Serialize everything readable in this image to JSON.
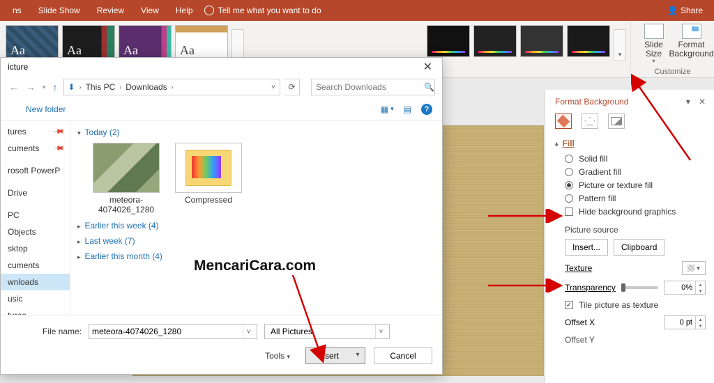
{
  "ribbon": {
    "tabs": [
      "ns",
      "Slide Show",
      "Review",
      "View",
      "Help"
    ],
    "tell_me": "Tell me what you want to do",
    "share": "Share"
  },
  "themes": {
    "aa": "Aa"
  },
  "customize": {
    "slide_size": "Slide\nSize",
    "format_bg": "Format\nBackground",
    "group": "Customize"
  },
  "panel": {
    "title": "Format Background",
    "section_fill": "Fill",
    "opt_solid": "Solid fill",
    "opt_gradient": "Gradient fill",
    "opt_picture": "Picture or texture fill",
    "opt_pattern": "Pattern fill",
    "chk_hide": "Hide background graphics",
    "picture_source": "Picture source",
    "btn_insert": "Insert...",
    "btn_clipboard": "Clipboard",
    "texture": "Texture",
    "transparency": "Transparency",
    "transparency_val": "0%",
    "tile": "Tile picture as texture",
    "offset_x": "Offset X",
    "offset_x_val": "0 pt",
    "offset_y": "Offset Y"
  },
  "dialog": {
    "title": "icture",
    "crumbs": [
      "This PC",
      "Downloads"
    ],
    "search_placeholder": "Search Downloads",
    "new_folder": "New folder",
    "sidebar": [
      "tures",
      "cuments",
      "rosoft PowerP",
      "Drive",
      "PC",
      "Objects",
      "sktop",
      "cuments",
      "wnloads",
      "usic",
      "tures"
    ],
    "sidebar_selected": 8,
    "groups": {
      "today": "Today (2)",
      "earlier_week": "Earlier this week (4)",
      "last_week": "Last week (7)",
      "earlier_month": "Earlier this month (4)"
    },
    "files": [
      {
        "name": "meteora-4074026_1280",
        "kind": "photo"
      },
      {
        "name": "Compressed",
        "kind": "folder"
      }
    ],
    "filename_label": "File name:",
    "filename_value": "meteora-4074026_1280",
    "filter": "All Pictures",
    "tools": "Tools",
    "btn_insert": "Insert",
    "btn_cancel": "Cancel"
  },
  "watermark": "MencariCara.com"
}
